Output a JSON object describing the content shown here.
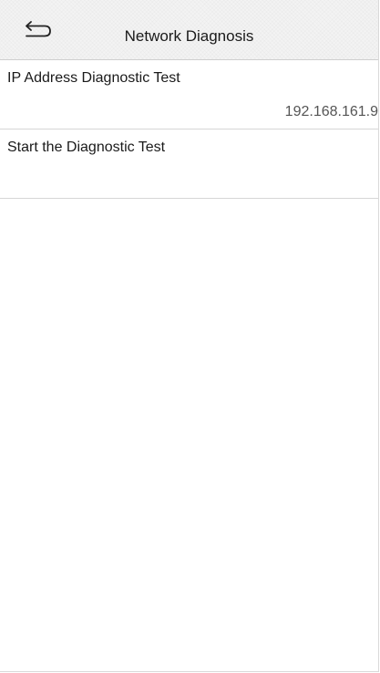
{
  "header": {
    "title": "Network Diagnosis",
    "back_icon": "back-arrow-icon"
  },
  "menu": {
    "items": [
      {
        "label": "IP Address Diagnostic Test",
        "value": "192.168.161.9"
      },
      {
        "label": "Start the Diagnostic Test",
        "value": ""
      }
    ]
  },
  "colors": {
    "header_background": "#f3f3f3",
    "divider": "#d6d6d6",
    "text": "#1a1a1a",
    "value_text": "#555555"
  }
}
